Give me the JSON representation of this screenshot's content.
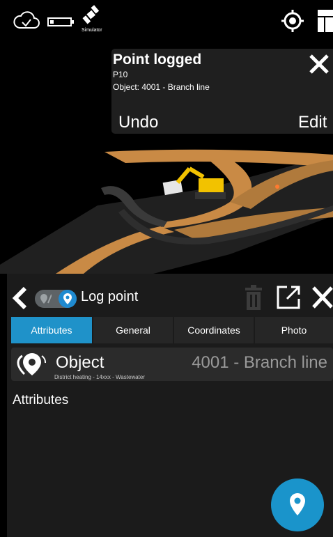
{
  "status_bar": {
    "icons": [
      "cloud-check-icon",
      "battery-icon",
      "satellite-icon",
      "target-icon",
      "map-layers-icon"
    ],
    "simulator_label": "Simulator"
  },
  "toast": {
    "title": "Point logged",
    "point_id": "P10",
    "object_line": "Object: 4001 - Branch line",
    "undo_label": "Undo",
    "edit_label": "Edit"
  },
  "panel": {
    "title": "Log point",
    "tabs": [
      {
        "label": "Attributes",
        "active": true
      },
      {
        "label": "General",
        "active": false
      },
      {
        "label": "Coordinates",
        "active": false
      },
      {
        "label": "Photo",
        "active": false
      }
    ],
    "object": {
      "label": "Object",
      "subtitle": "District heating - 14xxx - Wastewater",
      "value": "4001 - Branch line"
    },
    "attributes_heading": "Attributes"
  },
  "colors": {
    "accent": "#1f92c9",
    "panel_bg": "#1b1b1b",
    "toast_bg": "#1f1f1f",
    "road": "#c98a45",
    "excavator": "#f2c200"
  }
}
